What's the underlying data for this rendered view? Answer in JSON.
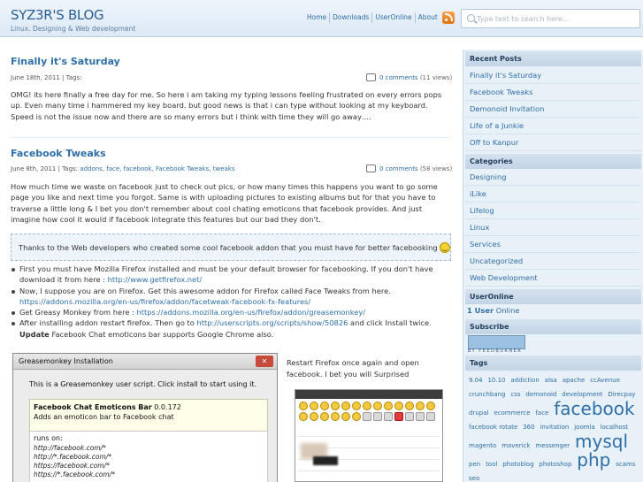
{
  "header": {
    "title": "SYZ3R'S BLOG",
    "tagline": "Linux. Designing & Web development",
    "nav": [
      "Home",
      "Downloads",
      "UserOnline",
      "About"
    ],
    "search_placeholder": "Type text to search here..."
  },
  "posts": [
    {
      "title": "Finally it's Saturday",
      "meta_date": "June 18th, 2011 | Tags:",
      "comments_link": "0 comments",
      "comments_views": "(11 views)",
      "body": "OMG! its here finally a free day for me. So here i am taking my typing lessons feeling frustrated on every errors pops up. Even many time i hammered my key board. but good news is that i can type without looking at my keyboard. Speed is not the issue now and there are so many errors but i think with time they will go away…."
    },
    {
      "title": "Facebook Tweaks",
      "meta_date": "June 8th, 2011 | Tags:",
      "meta_tags": "addons, face, facebook, Facebook Tweaks, tweaks",
      "comments_link": "0 comments",
      "comments_views": "(58 views)",
      "body": "How much time we waste on facebook just to check out pics, or how many times this happens you want to go some page you like and next time you forgot. Same is with uploading pictures to existing albums but for that you have to traverse a little long & I bet you don't remember about cool chating emoticons that facebook provides. And just imagine how cool it would if facebook integrate this features but our bad they don't.",
      "quote": "Thanks to the Web developers who created some cool facebook addon that you must have for better facebooking",
      "bullets": [
        {
          "text": "First you must have Mozilla Firefox installed and must be your default browser for facebooking. If you don't have download it from here :",
          "link": "http://www.getfirefox.net/"
        },
        {
          "text": "Now, I suppose you are on Firefox. Get this awesome addon for Firefox called Face Tweaks from here.",
          "link": "https://addons.mozilla.org/en-us/firefox/addon/facetweak-facebook-fx-features/"
        },
        {
          "text": "Get Greasy Monkey from here :",
          "link": "https://addons.mozilla.org/en-us/firefox/addon/greasemonkey/"
        },
        {
          "text": "After installing addon restart firefox. Then go to",
          "link": "http://userscripts.org/scripts/show/50826",
          "text_after": "and click Install twice.",
          "bold": "Update",
          "text_end": "Facebook Chat emoticons bar supports Google Chrome also."
        }
      ],
      "dialog": {
        "title": "Greasemonkey Installation",
        "message": "This is a Greasemonkey user script. Click install to start using it.",
        "script_name": "Facebook Chat Emoticons Bar",
        "script_version": "0.0.172",
        "script_desc": "Adds an emoticon bar to Facebook chat",
        "runs_on_label": "runs on:",
        "runs_on": [
          "http://facebook.com/*",
          "http://*.facebook.com/*",
          "https://facebook.com/*",
          "https://*.facebook.com/*"
        ]
      },
      "restart_text": "Restart Firefox once again and open facebook. I bet you will Surprised"
    }
  ],
  "sidebar": {
    "recent_heading": "Recent Posts",
    "recent": [
      "Finally it's Saturday",
      "Facebook Tweaks",
      "Demonoid Invitation",
      "Life of a Junkie",
      "Off to Kanpur"
    ],
    "categories_heading": "Categories",
    "categories": [
      "Designing",
      "iLike",
      "Lifelog",
      "Linux",
      "Services",
      "Uncategorized",
      "Web Development"
    ],
    "useronline_heading": "UserOnline",
    "useronline_count": "1 User",
    "useronline_suffix": "Online",
    "subscribe_heading": "Subscribe",
    "feedburner_text": "BY FEEDBURNER",
    "tags_heading": "Tags",
    "tags": [
      {
        "t": "9.04",
        "s": 7
      },
      {
        "t": "10.10",
        "s": 7
      },
      {
        "t": "addiction",
        "s": 7
      },
      {
        "t": "alsa",
        "s": 7
      },
      {
        "t": "apache",
        "s": 7
      },
      {
        "t": "ccAvenue",
        "s": 7
      },
      {
        "t": "crunchbang",
        "s": 7
      },
      {
        "t": "css",
        "s": 7
      },
      {
        "t": "demonoid",
        "s": 7
      },
      {
        "t": "development",
        "s": 7
      },
      {
        "t": "Direcpay",
        "s": 7
      },
      {
        "t": "drupal",
        "s": 7
      },
      {
        "t": "ecommerce",
        "s": 7
      },
      {
        "t": "face",
        "s": 7
      },
      {
        "t": "facebook",
        "s": 20
      },
      {
        "t": "facebook rotate",
        "s": 7
      },
      {
        "t": "360",
        "s": 7
      },
      {
        "t": "invitation",
        "s": 7
      },
      {
        "t": "joomla",
        "s": 7
      },
      {
        "t": "localhost",
        "s": 7
      },
      {
        "t": "magento",
        "s": 7
      },
      {
        "t": "maverick",
        "s": 7
      },
      {
        "t": "messenger",
        "s": 7
      },
      {
        "t": "mysql",
        "s": 20
      },
      {
        "t": "pen",
        "s": 7
      },
      {
        "t": "tool",
        "s": 7
      },
      {
        "t": "photoblog",
        "s": 7
      },
      {
        "t": "photoshop",
        "s": 7
      },
      {
        "t": "php",
        "s": 20
      },
      {
        "t": "scams",
        "s": 7
      },
      {
        "t": "seo",
        "s": 7
      }
    ]
  }
}
